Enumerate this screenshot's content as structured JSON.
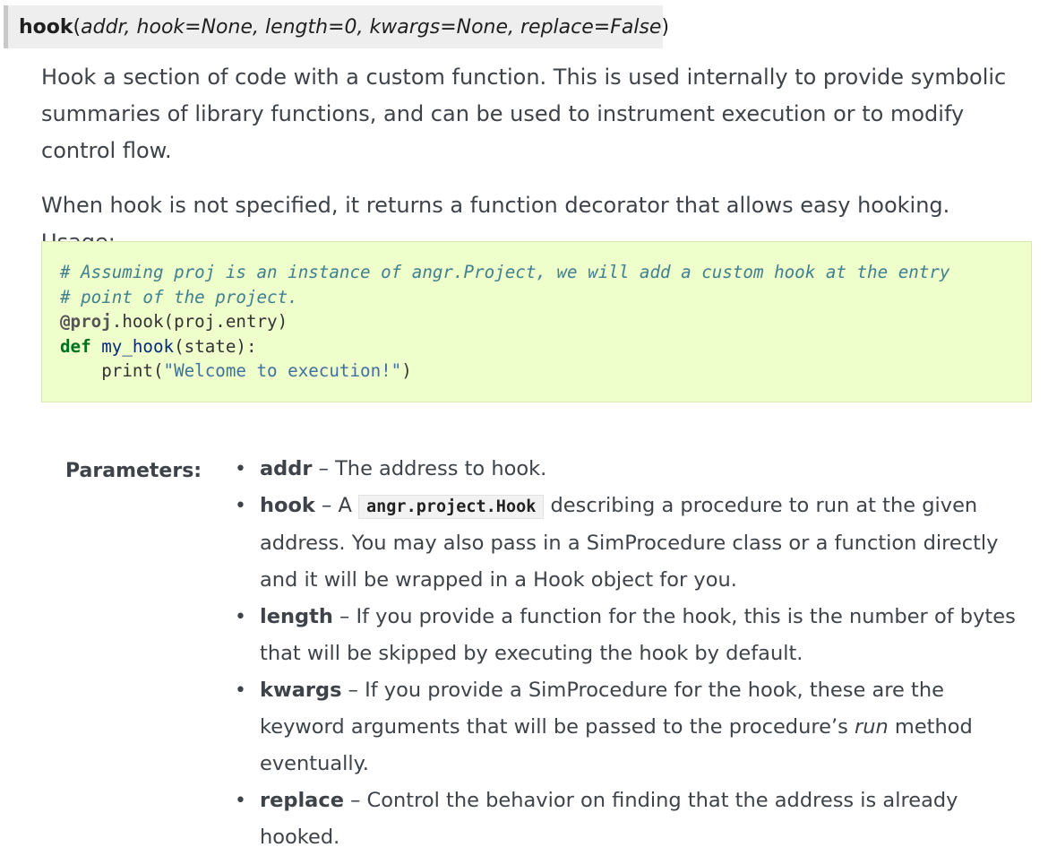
{
  "signature": {
    "name": "hook",
    "open": "(",
    "params": "addr, hook=None, length=0, kwargs=None, replace=False",
    "close": ")"
  },
  "description": {
    "p1": "Hook a section of code with a custom function. This is used internally to provide symbolic summaries of library functions, and can be used to instrument execution or to modify control flow.",
    "p2": "When hook is not specified, it returns a function decorator that allows easy hooking. Usage:"
  },
  "code": {
    "line1": "# Assuming proj is an instance of angr.Project, we will add a custom hook at the entry",
    "line2": "# point of the project.",
    "line3_deco": "@proj",
    "line3_rest": ".hook(proj.entry)",
    "line4_kw": "def",
    "line4_sp": " ",
    "line4_fn": "my_hook",
    "line4_rest": "(state):",
    "line5_indent": "    ",
    "line5_call": "print(",
    "line5_str": "\"Welcome to execution!\"",
    "line5_close": ")"
  },
  "parameters": {
    "label": "Parameters:",
    "bullet": "•",
    "items": [
      {
        "name": "addr",
        "sep": " – ",
        "text": "The address to hook."
      },
      {
        "name": "hook",
        "sep": " – ",
        "text_before": "A ",
        "code": "angr.project.Hook",
        "text_after": " describing a procedure to run at the given address. You may also pass in a SimProcedure class or a function directly and it will be wrapped in a Hook object for you."
      },
      {
        "name": "length",
        "sep": " – ",
        "text": "If you provide a function for the hook, this is the number of bytes that will be skipped by executing the hook by default."
      },
      {
        "name": "kwargs",
        "sep": " – ",
        "text_before": "If you provide a SimProcedure for the hook, these are the keyword arguments that will be passed to the procedure’s ",
        "emph": "run",
        "text_after": " method eventually."
      },
      {
        "name": "replace",
        "sep": " – ",
        "text": "Control the behavior on finding that the address is already hooked."
      }
    ]
  }
}
